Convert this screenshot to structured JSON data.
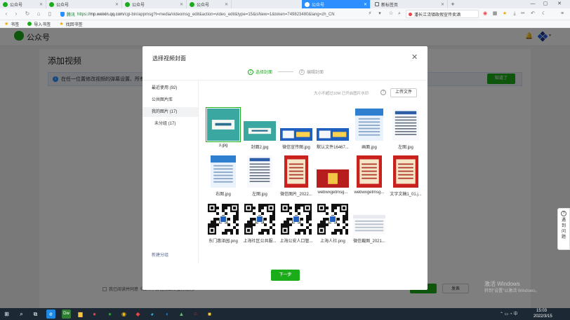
{
  "browser": {
    "tabs": [
      {
        "label": "公众号",
        "active": false
      },
      {
        "label": "公众号",
        "active": false
      },
      {
        "label": "公众号",
        "active": false
      },
      {
        "label": "公众号",
        "active": false
      },
      {
        "label": "公众号",
        "active": true
      },
      {
        "label": "新标签页",
        "active": false
      }
    ],
    "add_tab_symbol": "+",
    "url": {
      "secure_label": "腾讯",
      "scheme": "https://",
      "host": "mp.weixin.qq.com",
      "path": "/cgi-bin/appmsg?t=media/videomsg_edit&action=video_edit&type=15&isNew=1&token=749823480&lang=zh_CN"
    },
    "news_snippet": "潘长江浇镇政假宣传卖酒"
  },
  "bookmarks": [
    {
      "label": "书签",
      "icon": "star-icon"
    },
    {
      "label": "导入书签",
      "icon": "import-icon"
    },
    {
      "label": "找回书签",
      "icon": "star-icon"
    }
  ],
  "page": {
    "logo_text": "公众号",
    "title": "添加视频",
    "tip_text": "在任一位置修改视频的弹幕设置、所有",
    "tip_button": "知道了",
    "agree_text": "我已阅读并同意《公众平台视频上传服务规则》",
    "save_button": "保存",
    "publish_button": "发表"
  },
  "modal": {
    "title": "选择视频封面",
    "steps": [
      {
        "num": "1",
        "label": "选择封面"
      },
      {
        "num": "2",
        "label": "编辑封面"
      }
    ],
    "sidebar": [
      {
        "label": "最近使用",
        "count": "(92)"
      },
      {
        "label": "公共图片库",
        "count": ""
      },
      {
        "label": "我的图片",
        "count": "(17)"
      },
      {
        "label": "未分组",
        "count": "(17)"
      }
    ],
    "new_group": "新建分组",
    "limit_text": "大小不超过10M 已开启图片水印",
    "help_symbol": "?",
    "upload_button": "上传文件",
    "images": [
      {
        "caption": "3.jpg",
        "kind": "banner-teal"
      },
      {
        "caption": "封面2.jpg",
        "kind": "banner-teal2"
      },
      {
        "caption": "微信宣传图.jpg",
        "kind": "banner-blue"
      },
      {
        "caption": "默认文件16467...",
        "kind": "banner-blue2"
      },
      {
        "caption": "画面.jpg",
        "kind": "poster-blue"
      },
      {
        "caption": "左图.jpg",
        "kind": "poster-doc"
      },
      {
        "caption": "右图.jpg",
        "kind": "poster-blue2"
      },
      {
        "caption": "左图.jpg",
        "kind": "poster-doc2"
      },
      {
        "caption": "微信图片_2022...",
        "kind": "poster-red"
      },
      {
        "caption": "webwxgetmsg...",
        "kind": "card-red"
      },
      {
        "caption": "webwxgetmsg...",
        "kind": "poster-red2"
      },
      {
        "caption": "文字文稿1_01.j...",
        "kind": "poster-red3"
      },
      {
        "caption": "东门惠泽园.png",
        "kind": "qr"
      },
      {
        "caption": "上海社区公共服...",
        "kind": "qr"
      },
      {
        "caption": "上海公安人口管...",
        "kind": "qr"
      },
      {
        "caption": "上海人社.png",
        "kind": "qr"
      },
      {
        "caption": "微信截图_2021...",
        "kind": "screenshot"
      }
    ],
    "next_button": "下一步",
    "close_symbol": "✕"
  },
  "float_widget": {
    "symbol": "?",
    "text": "遇到问题"
  },
  "watermark": {
    "line1": "激活 Windows",
    "line2": "转到\"设置\"以激活 Windows。"
  },
  "taskbar": {
    "time": "15:03",
    "date": "2022/3/15"
  },
  "colors": {
    "accent": "#1aad19",
    "tab_active": "#2b8fff",
    "link": "#576b95"
  }
}
